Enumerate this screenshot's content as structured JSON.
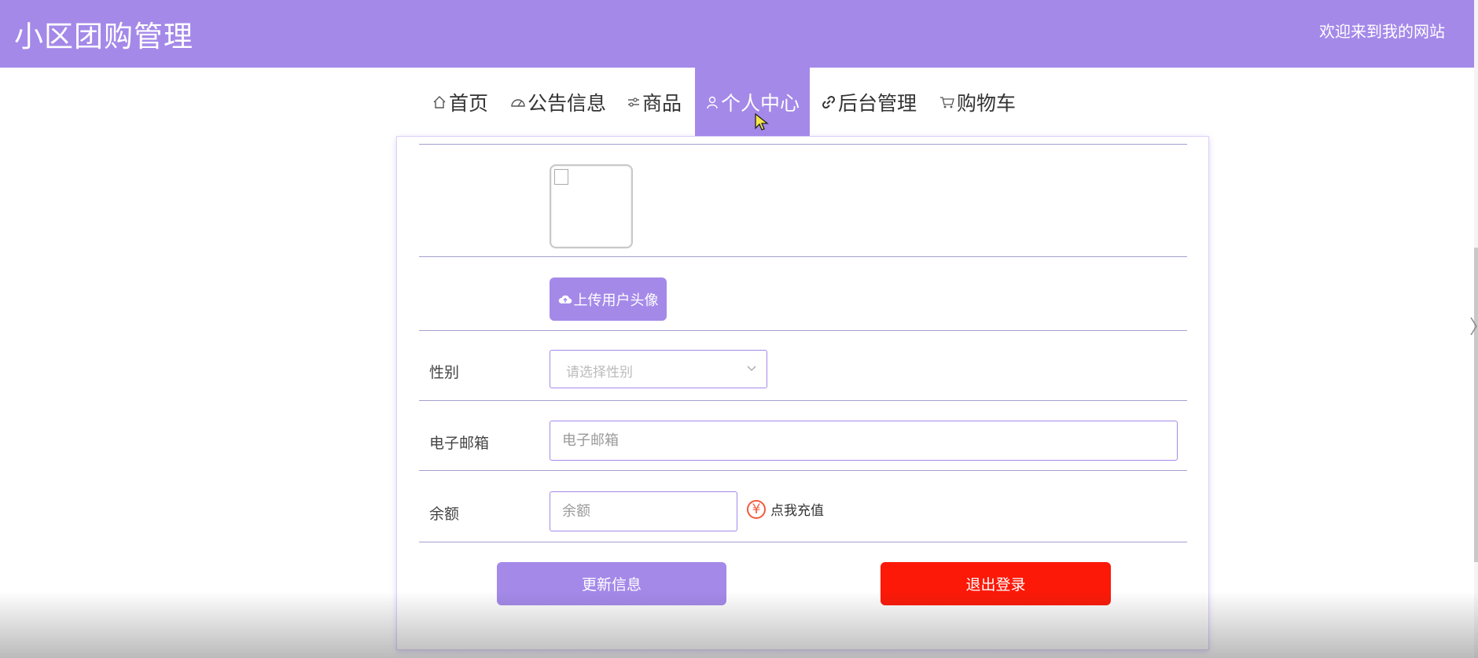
{
  "header": {
    "site_title": "小区团购管理",
    "welcome_text": "欢迎来到我的网站"
  },
  "nav": {
    "items": [
      {
        "label": "首页",
        "icon": "home-icon"
      },
      {
        "label": "公告信息",
        "icon": "gauge-icon"
      },
      {
        "label": "商品",
        "icon": "sliders-icon"
      },
      {
        "label": "个人中心",
        "icon": "user-icon",
        "active": true
      },
      {
        "label": "后台管理",
        "icon": "link-icon"
      },
      {
        "label": "购物车",
        "icon": "cart-icon"
      }
    ]
  },
  "form": {
    "avatar_label": "",
    "upload_button_label": "上传用户头像",
    "gender": {
      "label": "性别",
      "placeholder": "请选择性别",
      "value": ""
    },
    "email": {
      "label": "电子邮箱",
      "placeholder": "电子邮箱",
      "value": ""
    },
    "balance": {
      "label": "余额",
      "placeholder": "余额",
      "value": ""
    },
    "recharge_icon_text": "¥",
    "recharge_label": "点我充值",
    "update_button_label": "更新信息",
    "logout_button_label": "退出登录"
  },
  "colors": {
    "primary": "#a489e9",
    "danger": "#fc1908",
    "recharge_icon": "#f25a3c"
  }
}
